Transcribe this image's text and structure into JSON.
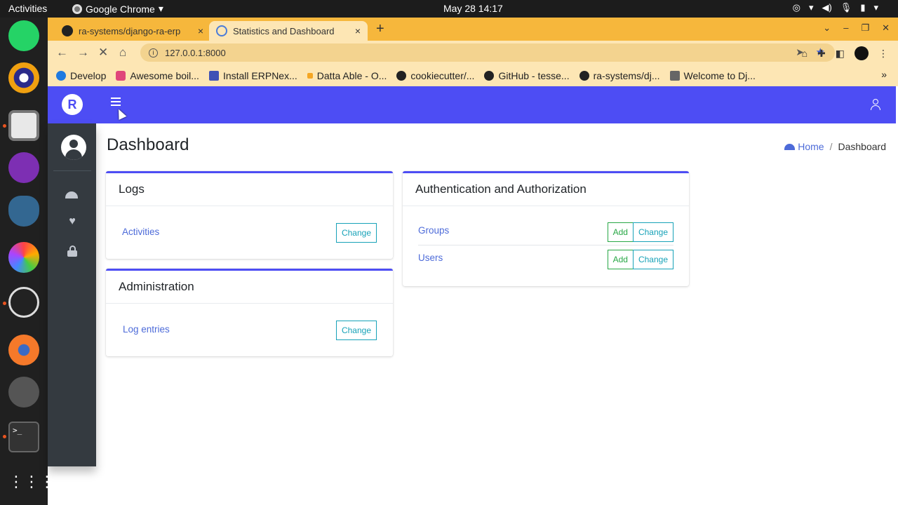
{
  "system": {
    "activities": "Activities",
    "app_name": "Google Chrome",
    "clock": "May 28  14:17"
  },
  "browser": {
    "tabs": [
      {
        "title": "ra-systems/django-ra-erp",
        "close": "×"
      },
      {
        "title": "Statistics and Dashboard",
        "close": "×"
      }
    ],
    "new_tab": "+",
    "url": "127.0.0.1:8000",
    "bookmarks": [
      "Develop",
      "Awesome boil...",
      "Install ERPNex...",
      "Datta Able - O...",
      "cookiecutter/...",
      "GitHub - tesse...",
      "ra-systems/dj...",
      "Welcome to Dj..."
    ],
    "bookmarks_more": "»"
  },
  "app": {
    "logo_letter": "R",
    "page_title": "Dashboard",
    "breadcrumb": {
      "home": "Home",
      "separator": "/",
      "current": "Dashboard"
    },
    "cards": {
      "logs": {
        "title": "Logs",
        "rows": [
          {
            "label": "Activities",
            "change": "Change"
          }
        ]
      },
      "administration": {
        "title": "Administration",
        "rows": [
          {
            "label": "Log entries",
            "change": "Change"
          }
        ]
      },
      "auth": {
        "title": "Authentication and Authorization",
        "rows": [
          {
            "label": "Groups",
            "add": "Add",
            "change": "Change"
          },
          {
            "label": "Users",
            "add": "Add",
            "change": "Change"
          }
        ]
      }
    }
  },
  "colors": {
    "header": "#4d4df4",
    "sidebar": "#343a40",
    "tabstrip": "#f6b73c",
    "link": "#4d6bd9",
    "button_green": "#28a745"
  },
  "icons": [
    "chrome-icon",
    "github-icon",
    "dashboard-gauge-icon",
    "heartbeat-icon",
    "lock-icon",
    "user-icon",
    "hamburger-menu-icon",
    "star-icon"
  ]
}
